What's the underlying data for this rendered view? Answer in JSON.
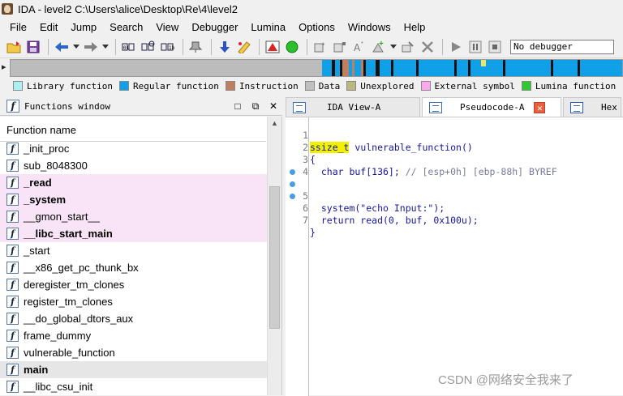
{
  "window": {
    "title": "IDA - level2 C:\\Users\\alice\\Desktop\\Re\\4\\level2"
  },
  "menu": [
    "File",
    "Edit",
    "Jump",
    "Search",
    "View",
    "Debugger",
    "Lumina",
    "Options",
    "Windows",
    "Help"
  ],
  "toolbar": {
    "debugger_select": "No debugger",
    "icons": [
      "open-icon",
      "save-icon",
      "back-arrow-icon",
      "forward-arrow-icon",
      "binary-icon",
      "hex-search-icon",
      "text-search-icon",
      "pin-icon",
      "jump-down-icon",
      "mark-icon",
      "warning-icon",
      "run-green-icon",
      "play-icon",
      "pause-icon",
      "stop-icon"
    ]
  },
  "legend": [
    {
      "label": "Library function",
      "color": "#aaf0f0"
    },
    {
      "label": "Regular function",
      "color": "#10a0e8"
    },
    {
      "label": "Instruction",
      "color": "#c08060"
    },
    {
      "label": "Data",
      "color": "#c0c0c0"
    },
    {
      "label": "Unexplored",
      "color": "#b8b880"
    },
    {
      "label": "External symbol",
      "color": "#ffa8f0"
    },
    {
      "label": "Lumina function",
      "color": "#30c830"
    }
  ],
  "functions_window": {
    "title": "Functions window",
    "column_header": "Function name",
    "items": [
      {
        "name": "_init_proc",
        "style": "normal"
      },
      {
        "name": "sub_8048300",
        "style": "normal"
      },
      {
        "name": "_read",
        "style": "extern"
      },
      {
        "name": "_system",
        "style": "extern"
      },
      {
        "name": "__gmon_start__",
        "style": "extern-plain"
      },
      {
        "name": "__libc_start_main",
        "style": "extern"
      },
      {
        "name": "_start",
        "style": "normal"
      },
      {
        "name": "__x86_get_pc_thunk_bx",
        "style": "normal"
      },
      {
        "name": "deregister_tm_clones",
        "style": "normal"
      },
      {
        "name": "register_tm_clones",
        "style": "normal"
      },
      {
        "name": "__do_global_dtors_aux",
        "style": "normal"
      },
      {
        "name": "frame_dummy",
        "style": "normal"
      },
      {
        "name": "vulnerable_function",
        "style": "normal"
      },
      {
        "name": "main",
        "style": "selected"
      },
      {
        "name": "__libc_csu_init",
        "style": "normal"
      }
    ]
  },
  "tabs": [
    {
      "label": "IDA View-A",
      "active": false
    },
    {
      "label": "Pseudocode-A",
      "active": true
    },
    {
      "label": "Hex",
      "active": false
    }
  ],
  "pseudocode": {
    "lines": [
      {
        "num": "1",
        "dot": false,
        "text": "ssize_t vulnerable_function()"
      },
      {
        "num": "2",
        "dot": false,
        "text": "{"
      },
      {
        "num": "3",
        "dot": false,
        "text": "  char buf[136]; // [esp+0h] [ebp-88h] BYREF"
      },
      {
        "num": "4",
        "dot": false,
        "text": ""
      },
      {
        "num": "5",
        "dot": true,
        "text": "  system(\"echo Input:\");"
      },
      {
        "num": "6",
        "dot": true,
        "text": "  return read(0, buf, 0x100u);"
      },
      {
        "num": "7",
        "dot": true,
        "text": "}"
      }
    ]
  },
  "watermark": "CSDN @网络安全我来了"
}
